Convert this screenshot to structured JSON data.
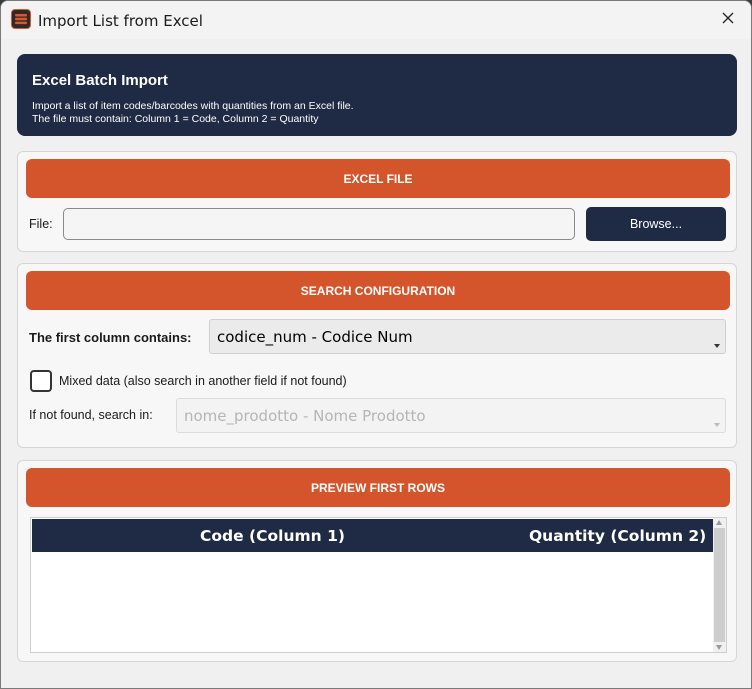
{
  "window": {
    "title": "Import List from Excel",
    "app_icon": "app-logo-icon",
    "close_icon": "close-icon"
  },
  "header": {
    "title": "Excel Batch Import",
    "desc_line1": "Import a list of item codes/barcodes with quantities from an Excel file.",
    "desc_line2": "The file must contain: Column 1 = Code, Column 2 = Quantity"
  },
  "excel_file": {
    "section_label": "EXCEL FILE",
    "file_label": "File:",
    "file_value": "",
    "browse_label": "Browse..."
  },
  "search_config": {
    "section_label": "SEARCH CONFIGURATION",
    "first_column_label": "The first column contains:",
    "first_column_value": "codice_num - Codice Num",
    "mixed_data_label": "Mixed data (also search in another field if not found)",
    "mixed_data_checked": false,
    "fallback_label": "If not found, search in:",
    "fallback_value": "nome_prodotto - Nome Prodotto"
  },
  "preview": {
    "section_label": "PREVIEW FIRST ROWS",
    "columns": [
      "Code (Column 1)",
      "Quantity (Column 2)"
    ],
    "rows": []
  },
  "colors": {
    "accent": "#d4552b",
    "navy": "#1f2a44"
  }
}
